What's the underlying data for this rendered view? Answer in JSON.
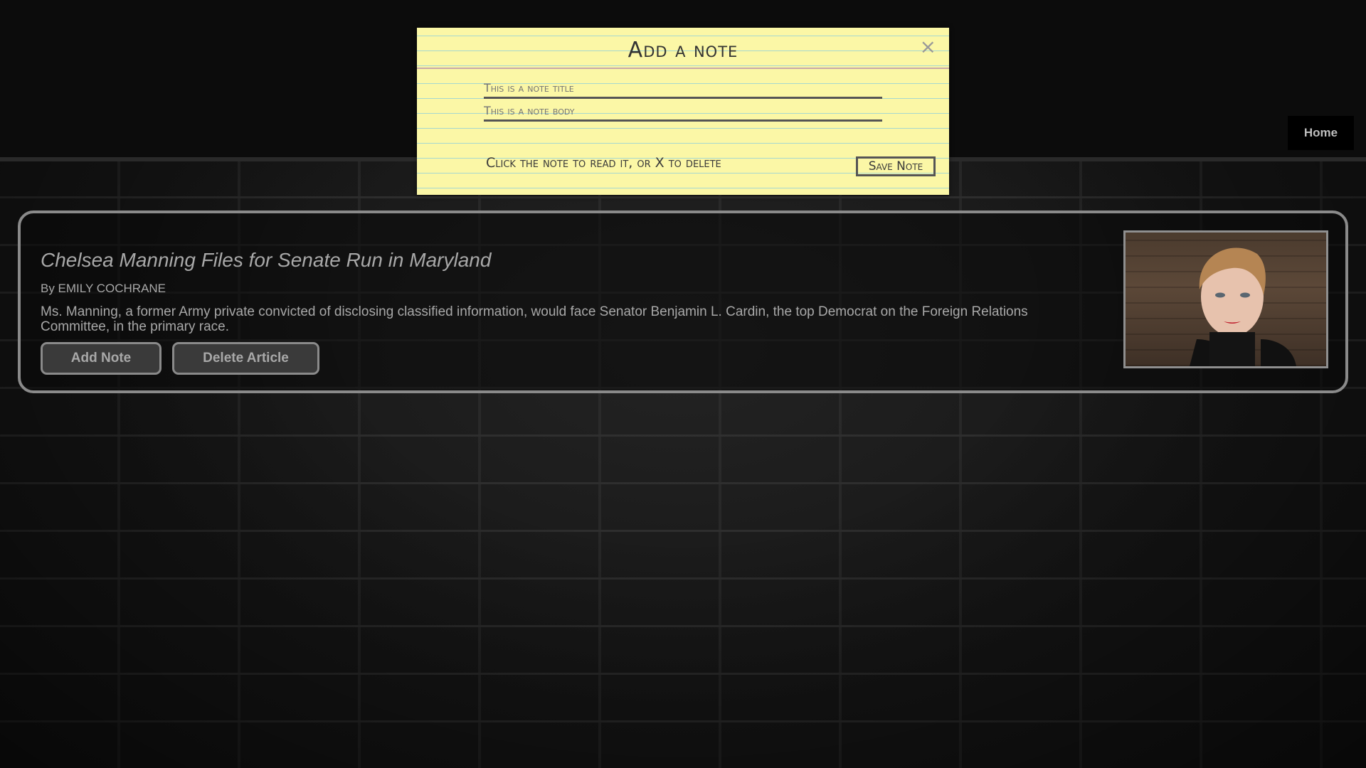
{
  "nav": {
    "home_label": "Home"
  },
  "article": {
    "title": "Chelsea Manning Files for Senate Run in Maryland",
    "byline": "By EMILY COCHRANE",
    "summary": "Ms. Manning, a former Army private convicted of disclosing classified information, would face Senator Benjamin L. Cardin, the top Democrat on the Foreign Relations Committee, in the primary race.",
    "add_note_label": "Add Note",
    "delete_article_label": "Delete Article"
  },
  "modal": {
    "title": "Add a note",
    "close_label": "×",
    "title_placeholder": "This is a note title",
    "body_placeholder": "This is a note body",
    "hint": "Click the note to read it, or X to delete",
    "save_label": "Save Note"
  }
}
